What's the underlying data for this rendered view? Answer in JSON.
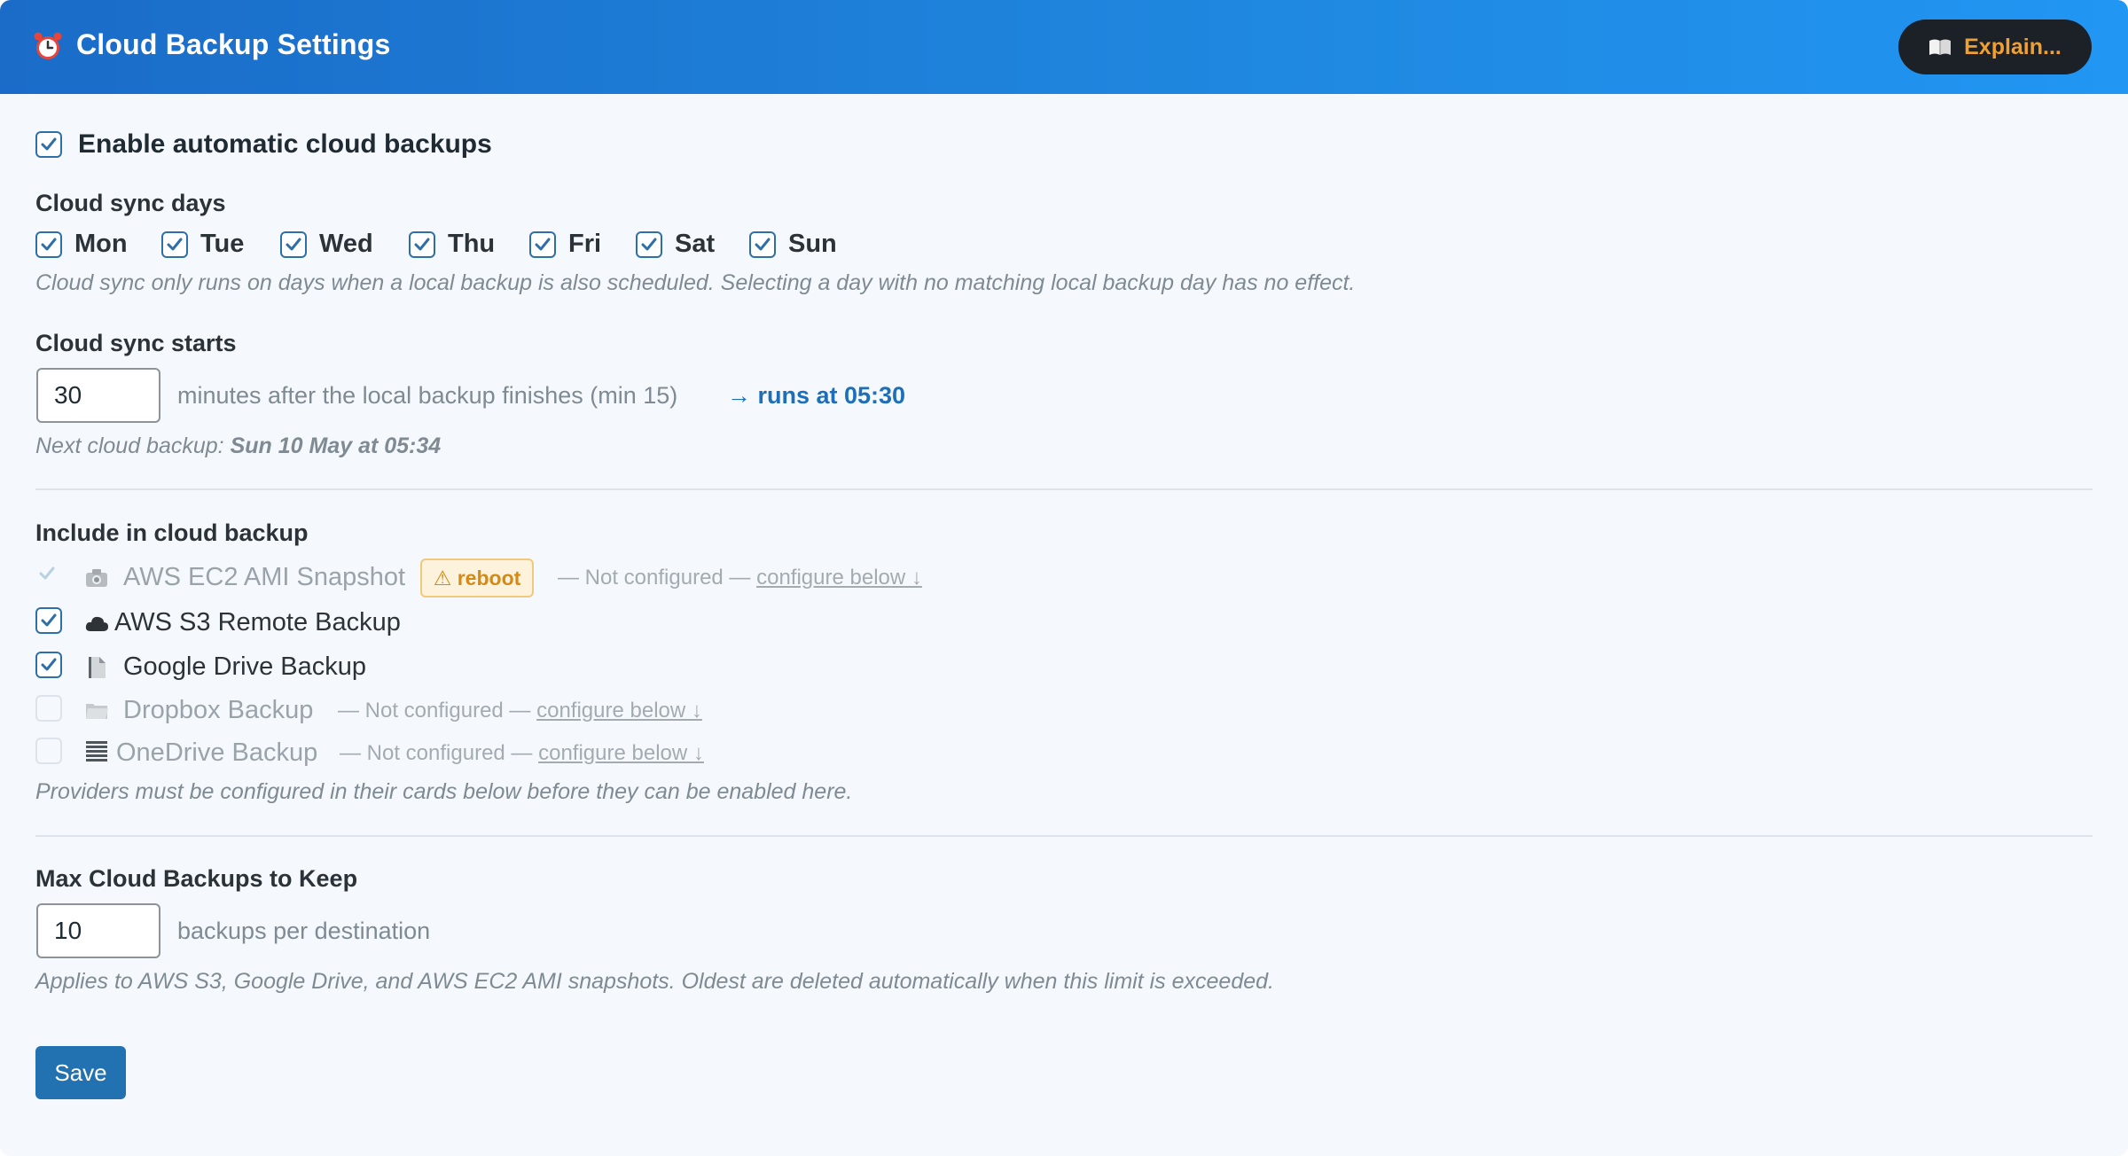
{
  "header": {
    "title": "Cloud Backup Settings",
    "explain_label": "Explain..."
  },
  "enable": {
    "label": "Enable automatic cloud backups",
    "checked": true
  },
  "days": {
    "title": "Cloud sync days",
    "items": [
      {
        "label": "Mon",
        "checked": true
      },
      {
        "label": "Tue",
        "checked": true
      },
      {
        "label": "Wed",
        "checked": true
      },
      {
        "label": "Thu",
        "checked": true
      },
      {
        "label": "Fri",
        "checked": true
      },
      {
        "label": "Sat",
        "checked": true
      },
      {
        "label": "Sun",
        "checked": true
      }
    ],
    "help": "Cloud sync only runs on days when a local backup is also scheduled. Selecting a day with no matching local backup day has no effect."
  },
  "sync_start": {
    "title": "Cloud sync starts",
    "value": "30",
    "suffix": "minutes after the local backup finishes (min 15)",
    "runs_at": "→ runs at 05:30",
    "next_label": "Next cloud backup:",
    "next_value": "Sun 10 May at 05:34"
  },
  "include": {
    "title": "Include in cloud backup",
    "providers": [
      {
        "icon": "camera-icon",
        "label": "AWS EC2 AMI Snapshot",
        "badge": "⚠ reboot",
        "not_configured": "— Not configured —",
        "link": "configure below ↓",
        "checked": true,
        "disabled": true
      },
      {
        "icon": "cloud-icon",
        "label": "AWS S3 Remote Backup",
        "checked": true,
        "disabled": false
      },
      {
        "icon": "document-icon",
        "label": "Google Drive Backup",
        "checked": true,
        "disabled": false
      },
      {
        "icon": "folder-icon",
        "label": "Dropbox Backup",
        "not_configured": "— Not configured —",
        "link": "configure below ↓",
        "checked": false,
        "disabled": true
      },
      {
        "icon": "list-icon",
        "label": "OneDrive Backup",
        "not_configured": "— Not configured —",
        "link": "configure below ↓",
        "checked": false,
        "disabled": true
      }
    ],
    "help": "Providers must be configured in their cards below before they can be enabled here."
  },
  "max_keep": {
    "title": "Max Cloud Backups to Keep",
    "value": "10",
    "suffix": "backups per destination",
    "help": "Applies to AWS S3, Google Drive, and AWS EC2 AMI snapshots. Oldest are deleted automatically when this limit is exceeded."
  },
  "save_label": "Save",
  "colors": {
    "header_start": "#1a6cc8",
    "header_end": "#2196f3",
    "accent": "#2271b1",
    "link": "#1f6fb8",
    "warning": "#d48a14"
  }
}
